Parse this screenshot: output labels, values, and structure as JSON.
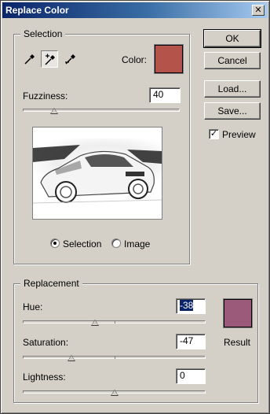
{
  "window": {
    "title": "Replace Color"
  },
  "selection": {
    "group_label": "Selection",
    "color_label": "Color:",
    "color": "#b35349",
    "fuzziness_label": "Fuzziness:",
    "fuzziness_value": "40",
    "fuzziness_level": 0.2,
    "tools": [
      "eyedropper-icon",
      "eyedropper-plus-icon",
      "eyedropper-minus-icon"
    ],
    "active_tool": "eyedropper-plus-icon",
    "view_options": [
      "Selection",
      "Image"
    ],
    "selected_view": "Selection"
  },
  "buttons": {
    "ok": "OK",
    "cancel": "Cancel",
    "load": "Load...",
    "save": "Save..."
  },
  "preview": {
    "label": "Preview",
    "checked": true
  },
  "replacement": {
    "group_label": "Replacement",
    "hue_label": "Hue:",
    "hue_value": "-38",
    "hue_level": -0.211,
    "saturation_label": "Saturation:",
    "saturation_value": "-47",
    "saturation_level": -0.47,
    "lightness_label": "Lightness:",
    "lightness_value": "0",
    "lightness_level": 0,
    "result_label": "Result",
    "result_color": "#9b5a7a"
  }
}
